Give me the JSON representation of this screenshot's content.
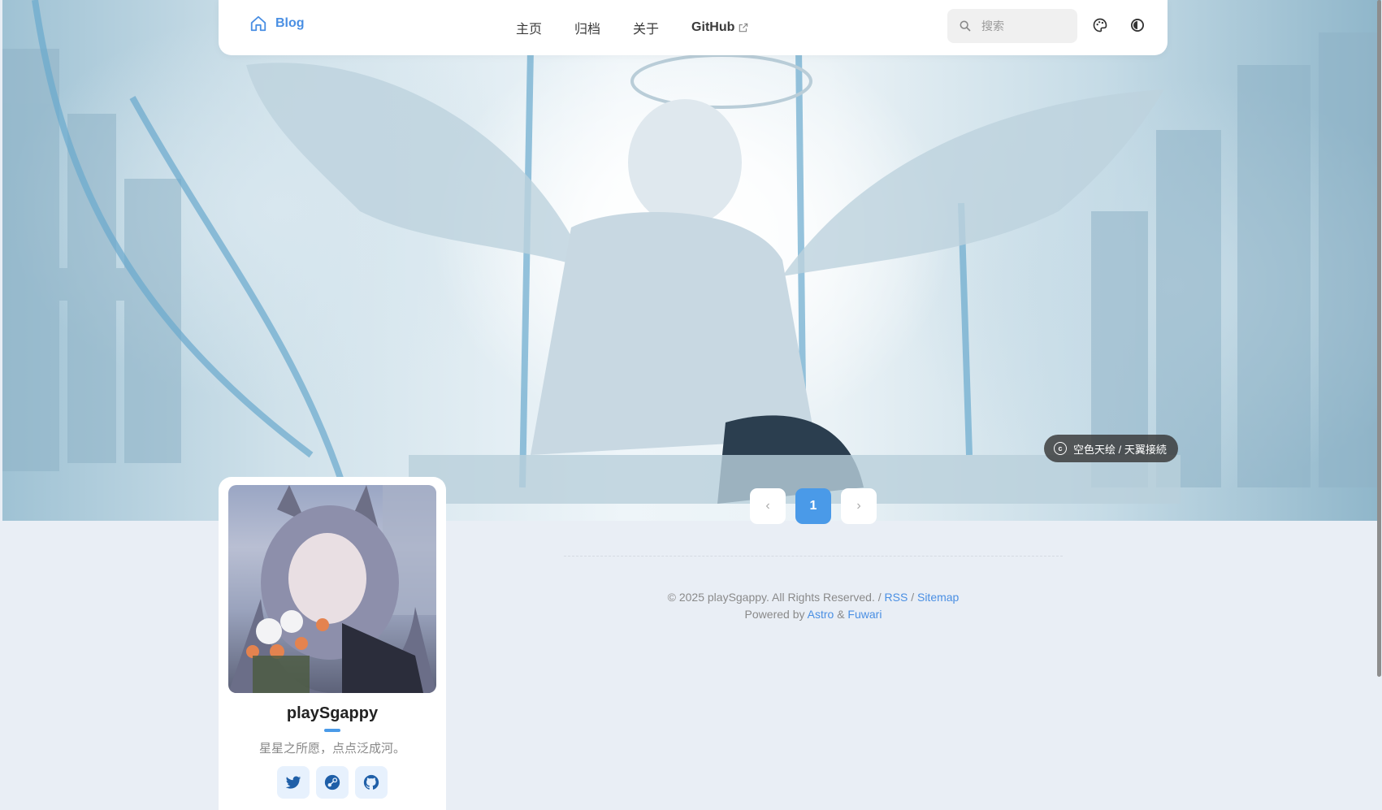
{
  "navbar": {
    "brand": "Blog",
    "links": [
      "主页",
      "归档",
      "关于"
    ],
    "github_label": "GitHub",
    "search_placeholder": "搜索",
    "icons": [
      "home-icon",
      "search-icon",
      "palette-icon",
      "theme-toggle-icon",
      "external-link-icon"
    ]
  },
  "banner": {
    "credit": "空色天绘 / 天翼接続",
    "credit_icon": "copyright-icon"
  },
  "pagination": {
    "prev_label": "‹",
    "current": "1",
    "next_label": "›"
  },
  "footer": {
    "line1_prefix": "© 2025 playSgappy. All Rights Reserved. /",
    "rss": "RSS",
    "sep": "/",
    "sitemap": "Sitemap",
    "line2_prefix": "Powered by",
    "astro": "Astro",
    "amp": "&",
    "fuwari": "Fuwari"
  },
  "profile": {
    "name": "playSgappy",
    "bio": "星星之所愿，点点泛成河。",
    "socials": [
      "twitter-icon",
      "steam-icon",
      "github-icon"
    ]
  },
  "colors": {
    "accent": "#4a9ae8",
    "page_bg": "#e9eef5",
    "card_bg": "#ffffff"
  }
}
